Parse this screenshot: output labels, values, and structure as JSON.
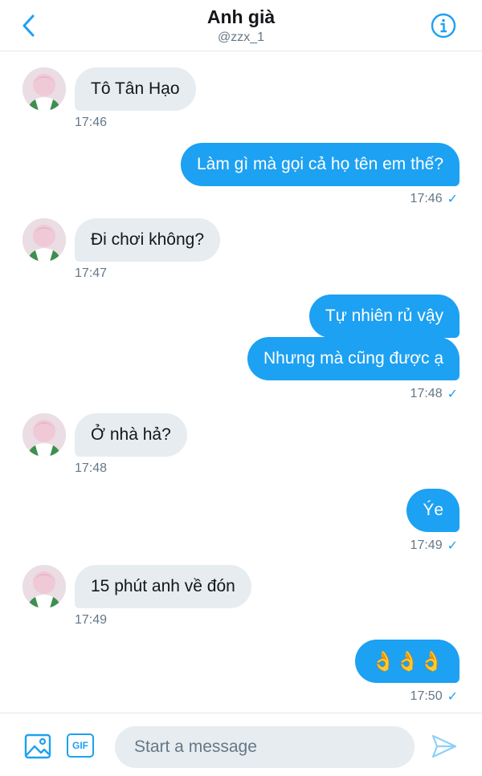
{
  "header": {
    "title": "Anh già",
    "handle": "@zzx_1"
  },
  "messages": [
    {
      "side": "in",
      "text": "Tô Tân Hạo",
      "time": "17:46"
    },
    {
      "side": "out",
      "text": "Làm gì mà gọi cả họ tên em thế?",
      "time": "17:46"
    },
    {
      "side": "in",
      "text": "Đi chơi không?",
      "time": "17:47"
    },
    {
      "side": "out",
      "text": "Tự nhiên rủ vậy"
    },
    {
      "side": "out",
      "text": "Nhưng mà cũng được ạ",
      "time": "17:48"
    },
    {
      "side": "in",
      "text": "Ở nhà hả?",
      "time": "17:48"
    },
    {
      "side": "out",
      "text": "Ýe",
      "time": "17:49"
    },
    {
      "side": "in",
      "text": "15 phút anh về đón",
      "time": "17:49"
    },
    {
      "side": "out",
      "text": "👌👌👌",
      "time": "17:50"
    }
  ],
  "read_mark": "✓",
  "composer": {
    "placeholder": "Start a message",
    "gif_label": "GIF"
  },
  "colors": {
    "accent": "#1da1f2",
    "incoming_bubble": "#e6ecf0",
    "timestamp": "#657786"
  },
  "icons": [
    "back-chevron-icon",
    "info-icon",
    "image-icon",
    "gif-icon",
    "send-icon"
  ]
}
